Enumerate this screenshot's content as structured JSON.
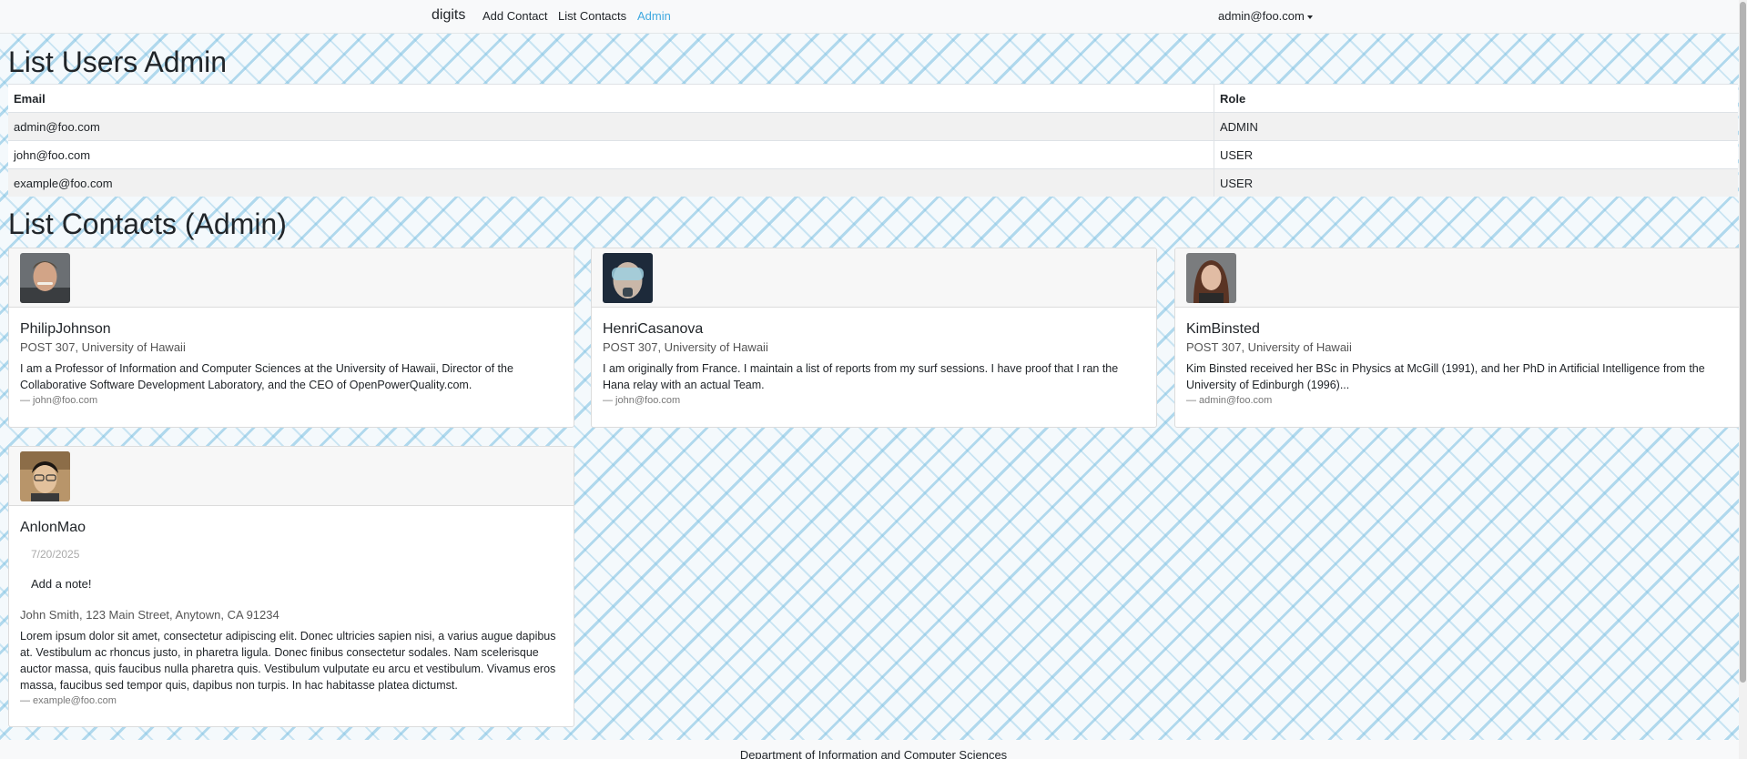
{
  "navbar": {
    "brand": "digits",
    "links": [
      "Add Contact",
      "List Contacts",
      "Admin"
    ],
    "user": "admin@foo.com"
  },
  "users_section": {
    "title": "List Users Admin",
    "columns": [
      "Email",
      "Role"
    ],
    "rows": [
      {
        "email": "admin@foo.com",
        "role": "ADMIN"
      },
      {
        "email": "john@foo.com",
        "role": "USER"
      },
      {
        "email": "example@foo.com",
        "role": "USER"
      }
    ]
  },
  "contacts_section": {
    "title": "List Contacts (Admin)",
    "cards": [
      {
        "name": "PhilipJohnson",
        "address": "POST 307, University of Hawaii",
        "description": "I am a Professor of Information and Computer Sciences at the University of Hawaii, Director of the Collaborative Software Development Laboratory, and the CEO of OpenPowerQuality.com.",
        "owner": "— john@foo.com"
      },
      {
        "name": "HenriCasanova",
        "address": "POST 307, University of Hawaii",
        "description": "I am originally from France. I maintain a list of reports from my surf sessions. I have proof that I ran the Hana relay with an actual Team.",
        "owner": "— john@foo.com"
      },
      {
        "name": "KimBinsted",
        "address": "POST 307, University of Hawaii",
        "description": "Kim Binsted received her BSc in Physics at McGill (1991), and her PhD in Artificial Intelligence from the University of Edinburgh (1996)...",
        "owner": "— admin@foo.com"
      },
      {
        "name": "AnlonMao",
        "note_date": "7/20/2025",
        "note_text": "Add a note!",
        "address": "John Smith, 123 Main Street, Anytown, CA 91234",
        "description": "Lorem ipsum dolor sit amet, consectetur adipiscing elit. Donec ultricies sapien nisi, a varius augue dapibus at. Vestibulum ac rhoncus justo, in pharetra ligula. Donec finibus consectetur sodales. Nam scelerisque auctor massa, quis faucibus nulla pharetra quis. Vestibulum vulputate eu arcu et vestibulum. Vivamus eros massa, faucibus sed tempor quis, dapibus non turpis. In hac habitasse platea dictumst.",
        "owner": "— example@foo.com"
      }
    ]
  },
  "footer": {
    "text": "Department of Information and Computer Sciences"
  }
}
